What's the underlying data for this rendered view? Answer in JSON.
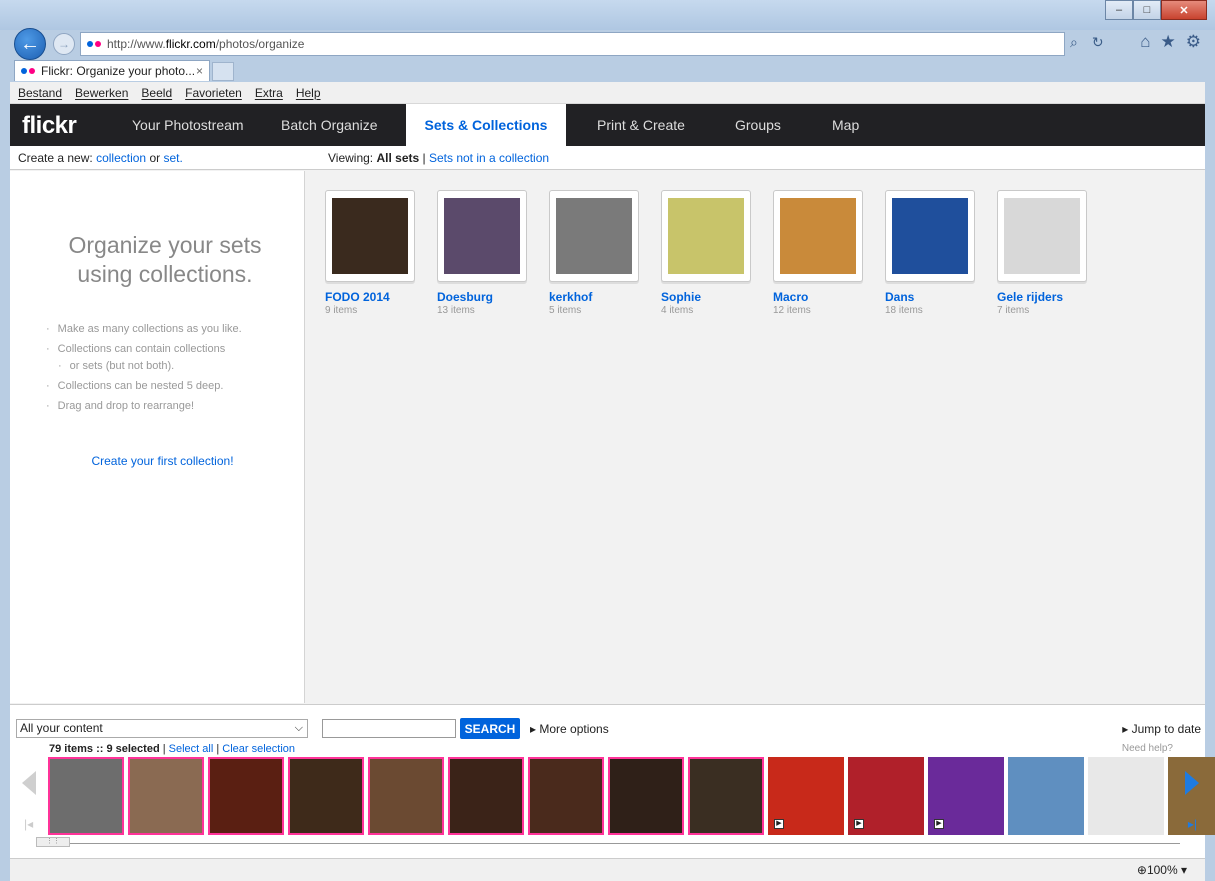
{
  "browser": {
    "url_prefix": "http://www.",
    "url_domain": "flickr.com",
    "url_path": "/photos/organize",
    "tab_title": "Flickr: Organize your photo...",
    "tab_close": "×",
    "menu": [
      "Bestand",
      "Bewerken",
      "Beeld",
      "Favorieten",
      "Extra",
      "Help"
    ],
    "zoom": "100%"
  },
  "flickr": {
    "logo": "flickr",
    "nav": [
      "Your Photostream",
      "Batch Organize",
      "Sets & Collections",
      "Print & Create",
      "Groups",
      "Map"
    ],
    "active_nav": "Sets & Collections",
    "create_prefix": "Create a new:",
    "create_collection": "collection",
    "create_or": "or",
    "create_set": "set.",
    "viewing_prefix": "Viewing:",
    "viewing_all": "All sets",
    "viewing_sep": "|",
    "viewing_other": "Sets not in a collection"
  },
  "left_panel": {
    "title": "Organize your sets using collections.",
    "tips": [
      "Make as many collections as you like.",
      "Collections can contain collections",
      "or sets (but not both).",
      "Collections can be nested 5 deep.",
      "Drag and drop to rearrange!"
    ],
    "cta": "Create your first collection!"
  },
  "sets": [
    {
      "name": "FODO 2014",
      "count": "9 items",
      "color": "#3a2a1e"
    },
    {
      "name": "Doesburg",
      "count": "13 items",
      "color": "#5b4a6b"
    },
    {
      "name": "kerkhof",
      "count": "5 items",
      "color": "#7a7a7a"
    },
    {
      "name": "Sophie",
      "count": "4 items",
      "color": "#c8c46a"
    },
    {
      "name": "Macro",
      "count": "12 items",
      "color": "#c98a3a"
    },
    {
      "name": "Dans",
      "count": "18 items",
      "color": "#1f4f9c"
    },
    {
      "name": "Gele rijders",
      "count": "7 items",
      "color": "#d8d8d8"
    }
  ],
  "organizer": {
    "filter": "All your content",
    "search_button": "SEARCH",
    "more_options": "More options",
    "jump_to_date": "Jump to date",
    "selection_info": "79 items :: 9 selected",
    "select_all": "Select all",
    "clear_selection": "Clear selection",
    "need_help": "Need help?",
    "photos": [
      {
        "color": "#6d6d6d",
        "selected": true,
        "video": false
      },
      {
        "color": "#8a6a52",
        "selected": true,
        "video": false
      },
      {
        "color": "#5a1f12",
        "selected": true,
        "video": false
      },
      {
        "color": "#3e2a1a",
        "selected": true,
        "video": false
      },
      {
        "color": "#6b4a32",
        "selected": true,
        "video": false
      },
      {
        "color": "#3b2318",
        "selected": true,
        "video": false
      },
      {
        "color": "#4a2a1c",
        "selected": true,
        "video": false
      },
      {
        "color": "#2f2018",
        "selected": true,
        "video": false
      },
      {
        "color": "#3a2e22",
        "selected": true,
        "video": false
      },
      {
        "color": "#c8291a",
        "selected": false,
        "video": true
      },
      {
        "color": "#b0202a",
        "selected": false,
        "video": true
      },
      {
        "color": "#6a2a9a",
        "selected": false,
        "video": true
      },
      {
        "color": "#5f8fc0",
        "selected": false,
        "video": false
      },
      {
        "color": "#e8e8e8",
        "selected": false,
        "video": false
      },
      {
        "color": "#8a6a3a",
        "selected": false,
        "video": false
      }
    ]
  }
}
